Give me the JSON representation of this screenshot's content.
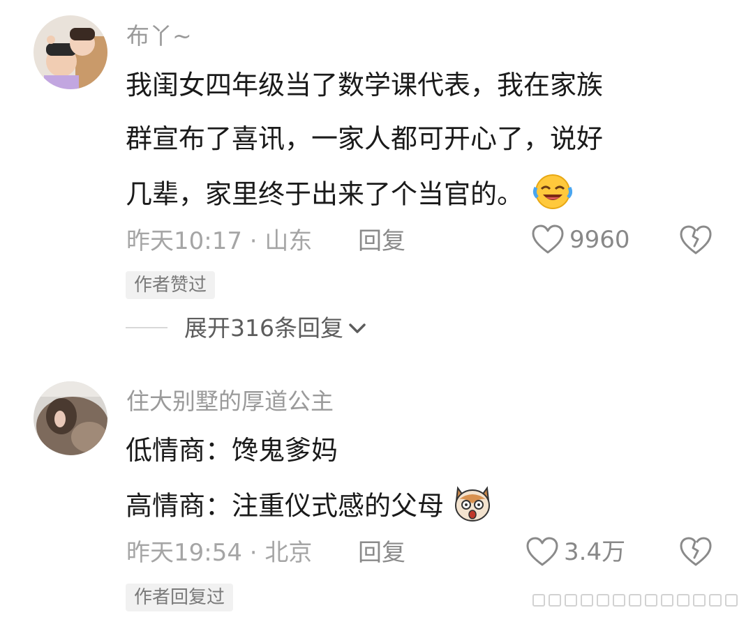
{
  "comments": [
    {
      "username": "布丫~",
      "lines": [
        "我闺女四年级当了数学课代表，我在家族",
        "群宣布了喜讯，一家人都可开心了，说好",
        "几辈，家里终于出来了个当官的。"
      ],
      "emoji": "laughing-tears-emoji",
      "timestamp": "昨天10:17 · 山东",
      "reply_label": "回复",
      "likes": "9960",
      "badge": "作者赞过",
      "expand_label": "展开316条回复"
    },
    {
      "username": "住大别墅的厚道公主",
      "lines": [
        "低情商：馋鬼爹妈",
        "高情商：注重仪式感的父母"
      ],
      "emoji": "shocked-dog-emoji",
      "timestamp": "昨天19:54 · 北京",
      "reply_label": "回复",
      "likes": "3.4万",
      "badge": "作者回复过"
    }
  ],
  "colors": {
    "meta_gray": "#a5a5a5",
    "text": "#1a1a1a",
    "badge_bg": "#f1f1f1"
  }
}
